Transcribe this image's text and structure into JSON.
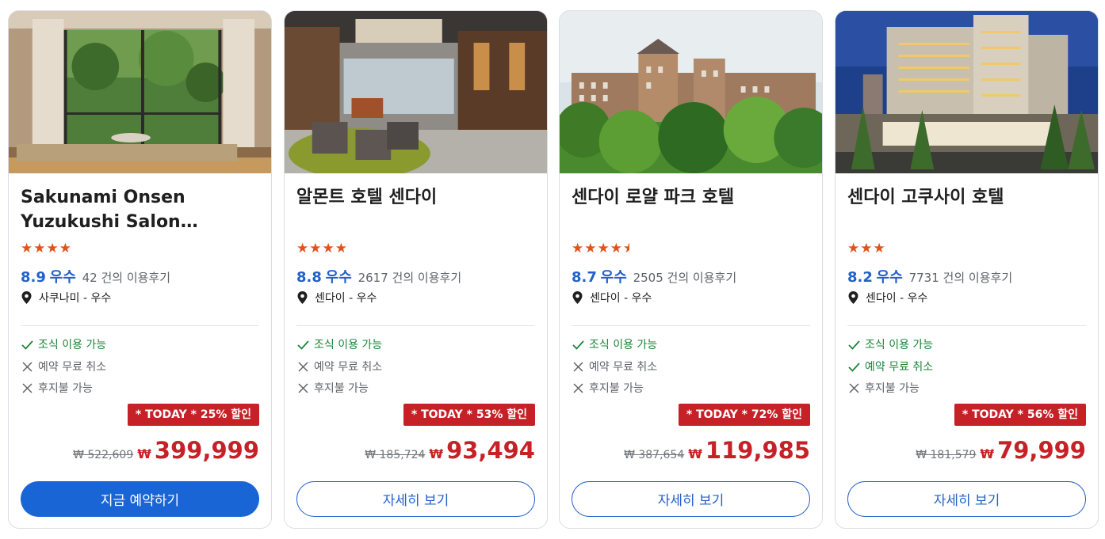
{
  "hotels": [
    {
      "name": "Sakunami Onsen Yuzukushi Salon Ichinobo",
      "stars": "★★★★",
      "score": "8.9",
      "rating_word": "우수",
      "review_count": "42",
      "review_suffix": "건의 이용후기",
      "location": "사쿠나미 - 우수",
      "amenities": [
        {
          "label": "조식 이용 가능",
          "available": true
        },
        {
          "label": "예약 무료 취소",
          "available": false
        },
        {
          "label": "후지불 가능",
          "available": false
        }
      ],
      "deal_badge": "* TODAY * 25% 할인",
      "original_price": "₩ 522,609",
      "currency": "₩",
      "price": "399,999",
      "button_label": "지금 예약하기"
    },
    {
      "name": "알몬트 호텔 센다이",
      "stars": "★★★★",
      "score": "8.8",
      "rating_word": "우수",
      "review_count": "2617",
      "review_suffix": "건의 이용후기",
      "location": "센다이 - 우수",
      "amenities": [
        {
          "label": "조식 이용 가능",
          "available": true
        },
        {
          "label": "예약 무료 취소",
          "available": false
        },
        {
          "label": "후지불 가능",
          "available": false
        }
      ],
      "deal_badge": "* TODAY * 53% 할인",
      "original_price": "₩ 185,724",
      "currency": "₩",
      "price": "93,494",
      "button_label": "자세히 보기"
    },
    {
      "name": "센다이 로얄 파크 호텔",
      "stars": "★★★★",
      "star_half": true,
      "score": "8.7",
      "rating_word": "우수",
      "review_count": "2505",
      "review_suffix": "건의 이용후기",
      "location": "센다이 - 우수",
      "amenities": [
        {
          "label": "조식 이용 가능",
          "available": true
        },
        {
          "label": "예약 무료 취소",
          "available": false
        },
        {
          "label": "후지불 가능",
          "available": false
        }
      ],
      "deal_badge": "* TODAY * 72% 할인",
      "original_price": "₩ 387,654",
      "currency": "₩",
      "price": "119,985",
      "button_label": "자세히 보기"
    },
    {
      "name": "센다이 고쿠사이 호텔",
      "stars": "★★★",
      "score": "8.2",
      "rating_word": "우수",
      "review_count": "7731",
      "review_suffix": "건의 이용후기",
      "location": "센다이 - 우수",
      "amenities": [
        {
          "label": "조식 이용 가능",
          "available": true
        },
        {
          "label": "예약 무료 취소",
          "available": true
        },
        {
          "label": "후지불 가능",
          "available": false
        }
      ],
      "deal_badge": "* TODAY * 56% 할인",
      "original_price": "₩ 181,579",
      "currency": "₩",
      "price": "79,999",
      "button_label": "자세히 보기"
    }
  ],
  "colors": {
    "accent_blue": "#2261c9",
    "primary_button": "#1a65d6",
    "deal_red": "#c62127",
    "star_orange": "#e0541a",
    "check_green": "#1a8537"
  }
}
